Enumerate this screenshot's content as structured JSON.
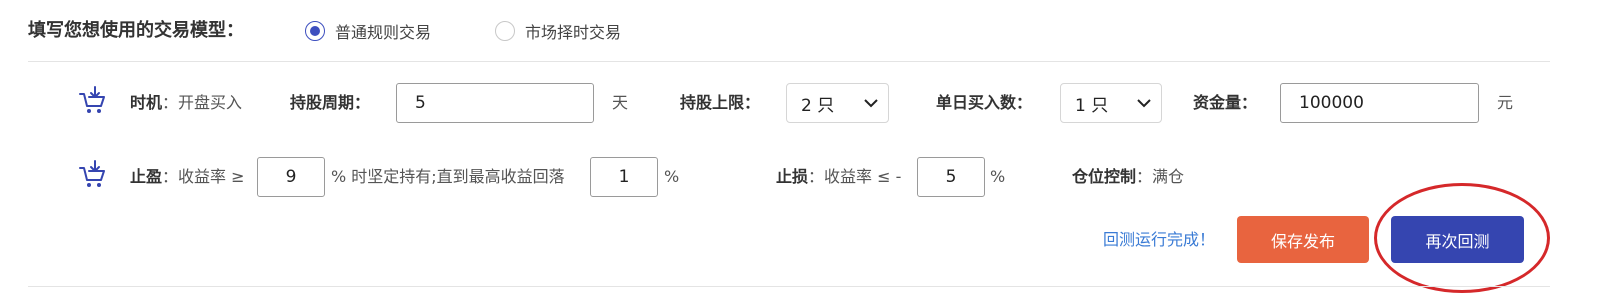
{
  "model": {
    "title": "填写您想使用的交易模型：",
    "options": [
      {
        "label": "普通规则交易",
        "checked": true
      },
      {
        "label": "市场择时交易",
        "checked": false
      }
    ]
  },
  "row1": {
    "icon": "cart-add-icon",
    "timing_label": "时机",
    "timing_sep": "：",
    "timing_value": "开盘买入",
    "hold_period_label": "持股周期：",
    "hold_period_value": "5",
    "hold_period_unit": "天",
    "hold_limit_label": "持股上限：",
    "hold_limit_value": "2 只",
    "daily_buy_label": "单日买入数：",
    "daily_buy_value": "1 只",
    "capital_label": "资金量：",
    "capital_value": "100000",
    "capital_unit": "元"
  },
  "row2": {
    "icon": "cart-add-icon",
    "take_profit_label": "止盈",
    "take_profit_text": "：收益率 ≥",
    "take_profit_value": "9",
    "take_profit_mid": "% 时坚定持有;直到最高收益回落",
    "drawdown_value": "1",
    "drawdown_unit": "%",
    "stop_loss_label": "止损",
    "stop_loss_text": "：收益率 ≤ -",
    "stop_loss_value": "5",
    "stop_loss_unit": "%",
    "position_label": "仓位控制",
    "position_text": "：满仓"
  },
  "actions": {
    "status": "回测运行完成！",
    "save_label": "保存发布",
    "retest_label": "再次回测"
  },
  "colors": {
    "accent": "#3545b0",
    "save": "#e8643f",
    "status": "#3a7bd5",
    "highlight": "#d5282a"
  }
}
